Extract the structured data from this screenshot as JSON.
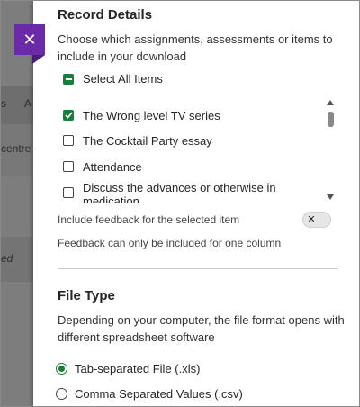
{
  "background": {
    "fragments": [
      "s",
      "A",
      "centre",
      "ed"
    ]
  },
  "close_button": {
    "icon": "close-icon",
    "glyph": "✕"
  },
  "record_details": {
    "title": "Record Details",
    "description": "Choose which assignments, assessments or items to include in your download",
    "select_all_label": "Select All Items",
    "items": [
      {
        "label": "The Wrong level TV series",
        "checked": true
      },
      {
        "label": "The Cocktail Party essay",
        "checked": false
      },
      {
        "label": "Attendance",
        "checked": false
      },
      {
        "label": "Discuss the advances or otherwise in medication",
        "checked": false
      }
    ]
  },
  "feedback": {
    "toggle_label": "Include feedback for the selected item",
    "toggle_glyph": "✕",
    "toggle_on": false,
    "note": "Feedback can only be included for one column"
  },
  "file_type": {
    "title": "File Type",
    "description": "Depending on your computer, the file format opens with different spreadsheet software",
    "options": [
      {
        "label": "Tab-separated File (.xls)",
        "selected": true
      },
      {
        "label": "Comma Separated Values (.csv)",
        "selected": false
      }
    ]
  },
  "colors": {
    "accent": "#1a7d3c",
    "close_bg": "#6b2aa8"
  }
}
